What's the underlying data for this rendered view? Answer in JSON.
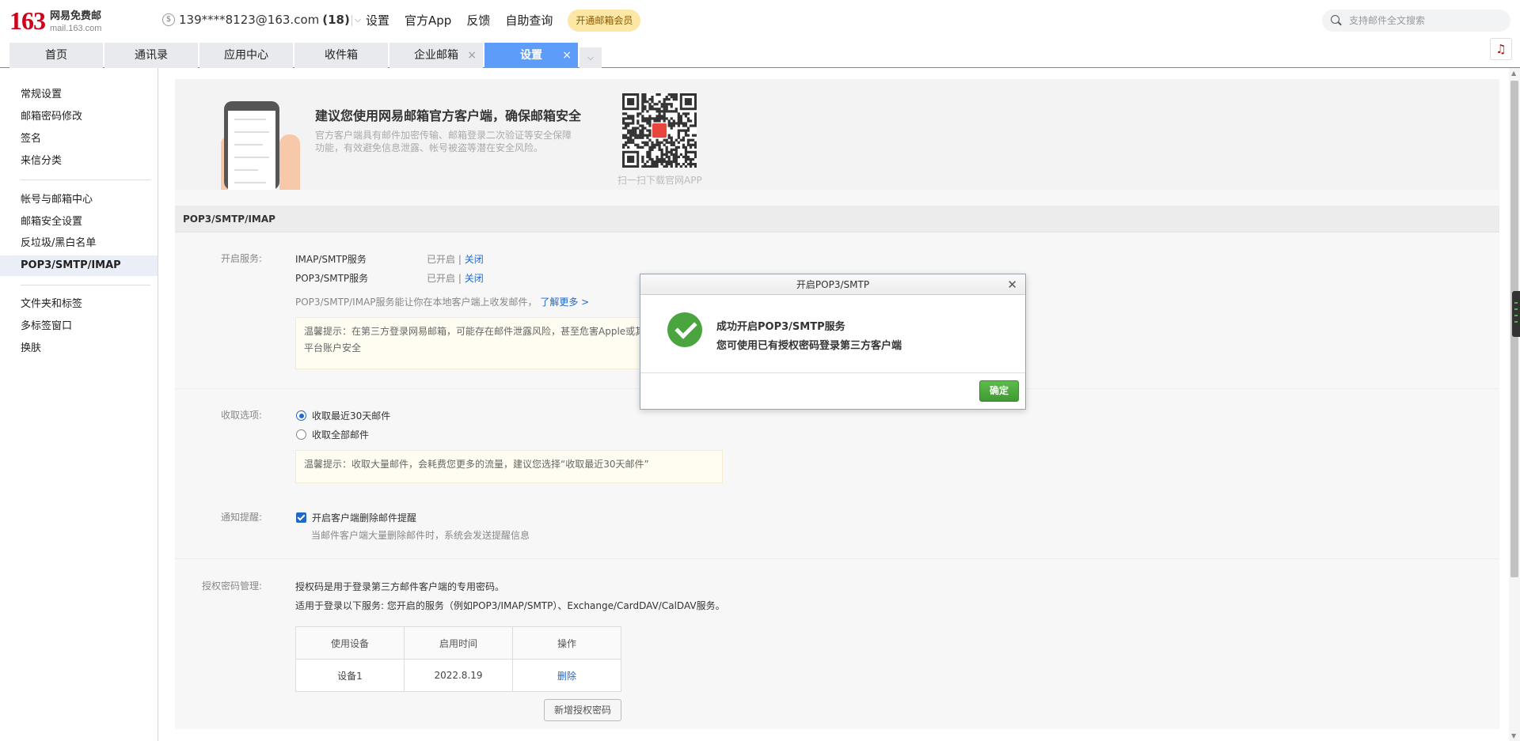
{
  "header": {
    "logo_number": "163",
    "logo_name": "网易免费邮",
    "logo_domain": "mail.163.com",
    "account_email": "139****8123@163.com",
    "account_count": "(18)",
    "links": [
      "设置",
      "官方App",
      "反馈",
      "自助查询"
    ],
    "vip_button": "开通邮箱会员",
    "search_placeholder": "支持邮件全文搜索"
  },
  "tabs": [
    {
      "label": "首页"
    },
    {
      "label": "通讯录"
    },
    {
      "label": "应用中心"
    },
    {
      "label": "收件箱"
    },
    {
      "label": "企业邮箱"
    },
    {
      "label": "设置"
    }
  ],
  "sidebar": {
    "items": [
      "常规设置",
      "邮箱密码修改",
      "签名",
      "来信分类",
      "帐号与邮箱中心",
      "邮箱安全设置",
      "反垃圾/黑白名单",
      "POP3/SMTP/IMAP",
      "文件夹和标签",
      "多标签窗口",
      "换肤"
    ],
    "active": "POP3/SMTP/IMAP"
  },
  "promo": {
    "title": "建议您使用网易邮箱官方客户端，确保邮箱安全",
    "desc": "官方客户端具有邮件加密传输、邮箱登录二次验证等安全保障功能，有效避免信息泄露、帐号被盗等潜在安全风险。",
    "qr_caption": "扫一扫下载官网APP"
  },
  "section": {
    "title": "POP3/SMTP/IMAP",
    "services_label": "开启服务:",
    "services": [
      {
        "name": "IMAP/SMTP服务",
        "status": "已开启",
        "action": "关闭"
      },
      {
        "name": "POP3/SMTP服务",
        "status": "已开启",
        "action": "关闭"
      }
    ],
    "services_note": "POP3/SMTP/IMAP服务能让你在本地客户端上收发邮件，",
    "learn_more": "了解更多 >",
    "warning_1": "温馨提示：在第三方登录网易邮箱，可能存在邮件泄露风险，甚至危害Apple或其他",
    "warning_2": "平台账户安全",
    "receive_label": "收取选项:",
    "receive_options": [
      "收取最近30天邮件",
      "收取全部邮件"
    ],
    "receive_hint": "温馨提示：收取大量邮件，会耗费您更多的流量，建议您选择“收取最近30天邮件”",
    "notify_label": "通知提醒:",
    "notify_option": "开启客户端删除邮件提醒",
    "notify_desc": "当邮件客户端大量删除邮件时，系统会发送提醒信息",
    "auth_label": "授权密码管理:",
    "auth_desc_1": "授权码是用于登录第三方邮件客户端的专用密码。",
    "auth_desc_2": "适用于登录以下服务: 您开启的服务（例如POP3/IMAP/SMTP）、Exchange/CardDAV/CalDAV服务。",
    "table_headers": [
      "使用设备",
      "启用时间",
      "操作"
    ],
    "table_rows": [
      {
        "device": "设备1",
        "time": "2022.8.19",
        "action": "删除"
      }
    ],
    "add_button": "新增授权密码"
  },
  "modal": {
    "title": "开启POP3/SMTP",
    "heading": "成功开启POP3/SMTP服务",
    "message": "您可使用已有授权密码登录第三方客户端",
    "ok": "确定"
  },
  "colors": {
    "brand_red": "#d0021b",
    "tab_active": "#5d9cf8",
    "link": "#2268c9",
    "success_green": "#4aa53f"
  }
}
